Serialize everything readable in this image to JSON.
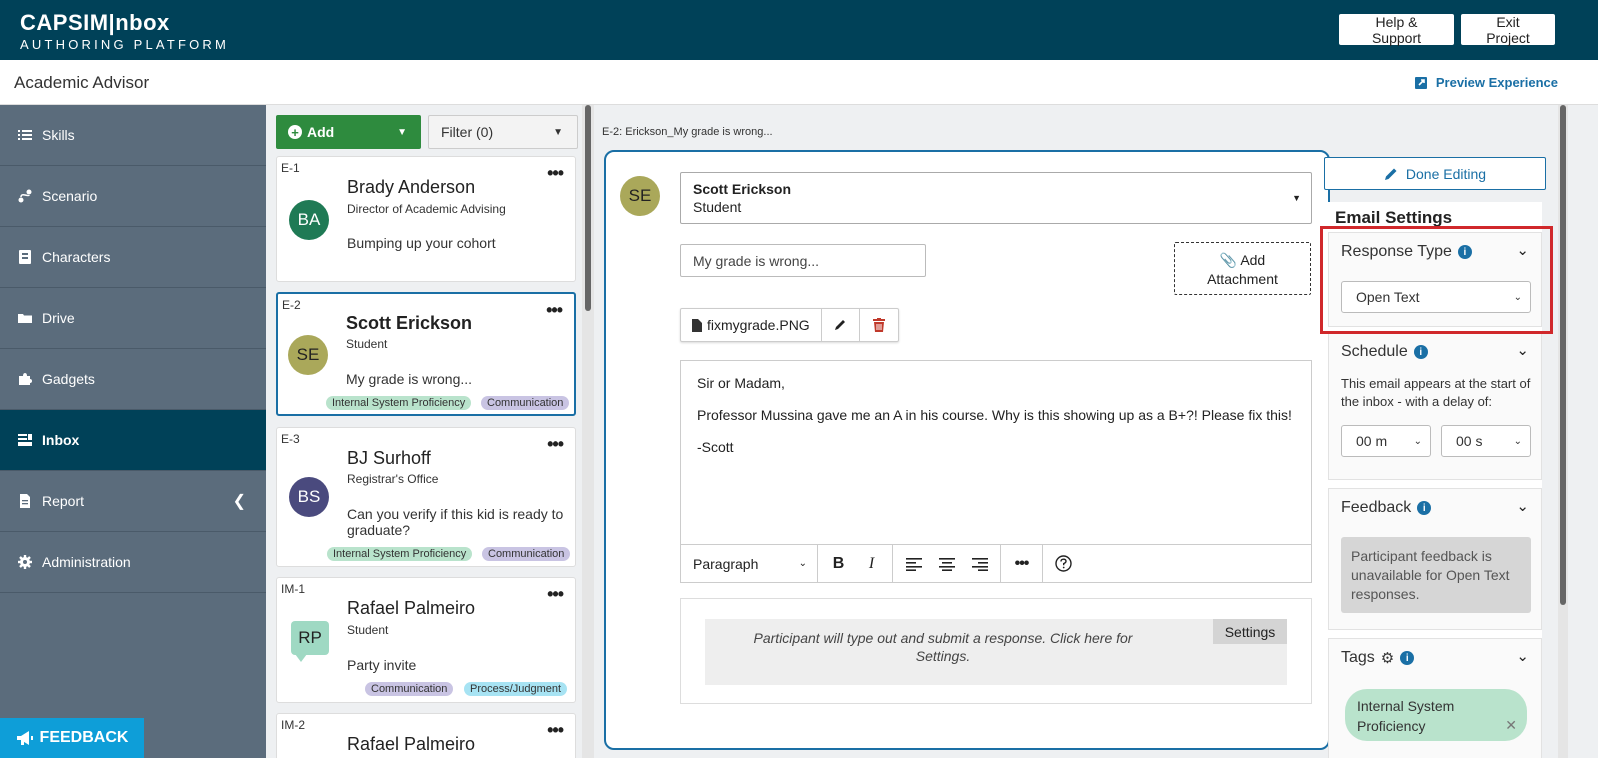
{
  "header": {
    "logo_main": "CAPSIM|nbox",
    "logo_sub": "AUTHORING PLATFORM",
    "help_label": "Help & Support",
    "exit_label": "Exit Project"
  },
  "subheader": {
    "title": "Academic Advisor",
    "preview_label": "Preview Experience"
  },
  "sidebar": {
    "items": [
      {
        "label": "Skills",
        "icon": "list-icon"
      },
      {
        "label": "Scenario",
        "icon": "scenario-icon"
      },
      {
        "label": "Characters",
        "icon": "characters-icon"
      },
      {
        "label": "Drive",
        "icon": "folder-icon"
      },
      {
        "label": "Gadgets",
        "icon": "puzzle-icon"
      },
      {
        "label": "Inbox",
        "icon": "inbox-icon",
        "active": true
      },
      {
        "label": "Report",
        "icon": "document-icon"
      },
      {
        "label": "Administration",
        "icon": "gear-icon"
      }
    ],
    "feedback_label": "FEEDBACK"
  },
  "list": {
    "add_label": "Add",
    "filter_label": "Filter (0)",
    "cards": [
      {
        "id": "E-1",
        "initials": "BA",
        "name": "Brady Anderson",
        "role": "Director of Academic Advising",
        "subject": "Bumping up your cohort",
        "tags": []
      },
      {
        "id": "E-2",
        "initials": "SE",
        "name": "Scott Erickson",
        "role": "Student",
        "subject": "My grade is wrong...",
        "tags": [
          "Internal System Proficiency",
          "Communication"
        ]
      },
      {
        "id": "E-3",
        "initials": "BS",
        "name": "BJ Surhoff",
        "role": "Registrar's Office",
        "subject": "Can you verify if this kid is ready to graduate?",
        "tags": [
          "Internal System Proficiency",
          "Communication"
        ]
      },
      {
        "id": "IM-1",
        "initials": "RP",
        "name": "Rafael Palmeiro",
        "role": "Student",
        "subject": "Party invite",
        "tags": [
          "Communication",
          "Process/Judgment"
        ]
      },
      {
        "id": "IM-2",
        "initials": "",
        "name": "Rafael Palmeiro",
        "role": "",
        "subject": "",
        "tags": []
      }
    ]
  },
  "editor": {
    "breadcrumb": "E-2: Erickson_My grade is wrong...",
    "avatar_initials": "SE",
    "from_name": "Scott Erickson",
    "from_role": "Student",
    "subject_value": "My grade is wrong...",
    "attach_label_1": "Add",
    "attach_label_2": "Attachment",
    "file_name": "fixmygrade.PNG",
    "body": [
      "Sir or Madam,",
      "Professor Mussina gave me an A in his course. Why is this showing up as a B+?! Please fix this!",
      "-Scott"
    ],
    "toolbar_format": "Paragraph",
    "response_text": "Participant will type out and submit a response. Click here for Settings.",
    "settings_label": "Settings"
  },
  "settings": {
    "done_label": "Done Editing",
    "title": "Email Settings",
    "response_type_label": "Response Type",
    "response_type_value": "Open Text",
    "schedule_label": "Schedule",
    "schedule_text": "This email appears at the start of the inbox - with a delay of:",
    "delay_minutes": "00 m",
    "delay_seconds": "00 s",
    "feedback_label": "Feedback",
    "feedback_text": "Participant feedback is unavailable for Open Text responses.",
    "tags_label": "Tags",
    "tag_value": "Internal System Proficiency"
  },
  "colors": {
    "header": "#004158",
    "sidebar": "#5b6c7c",
    "accent": "#1a6fa5",
    "add_green": "#2e8b3e",
    "highlight": "#d0282b"
  }
}
